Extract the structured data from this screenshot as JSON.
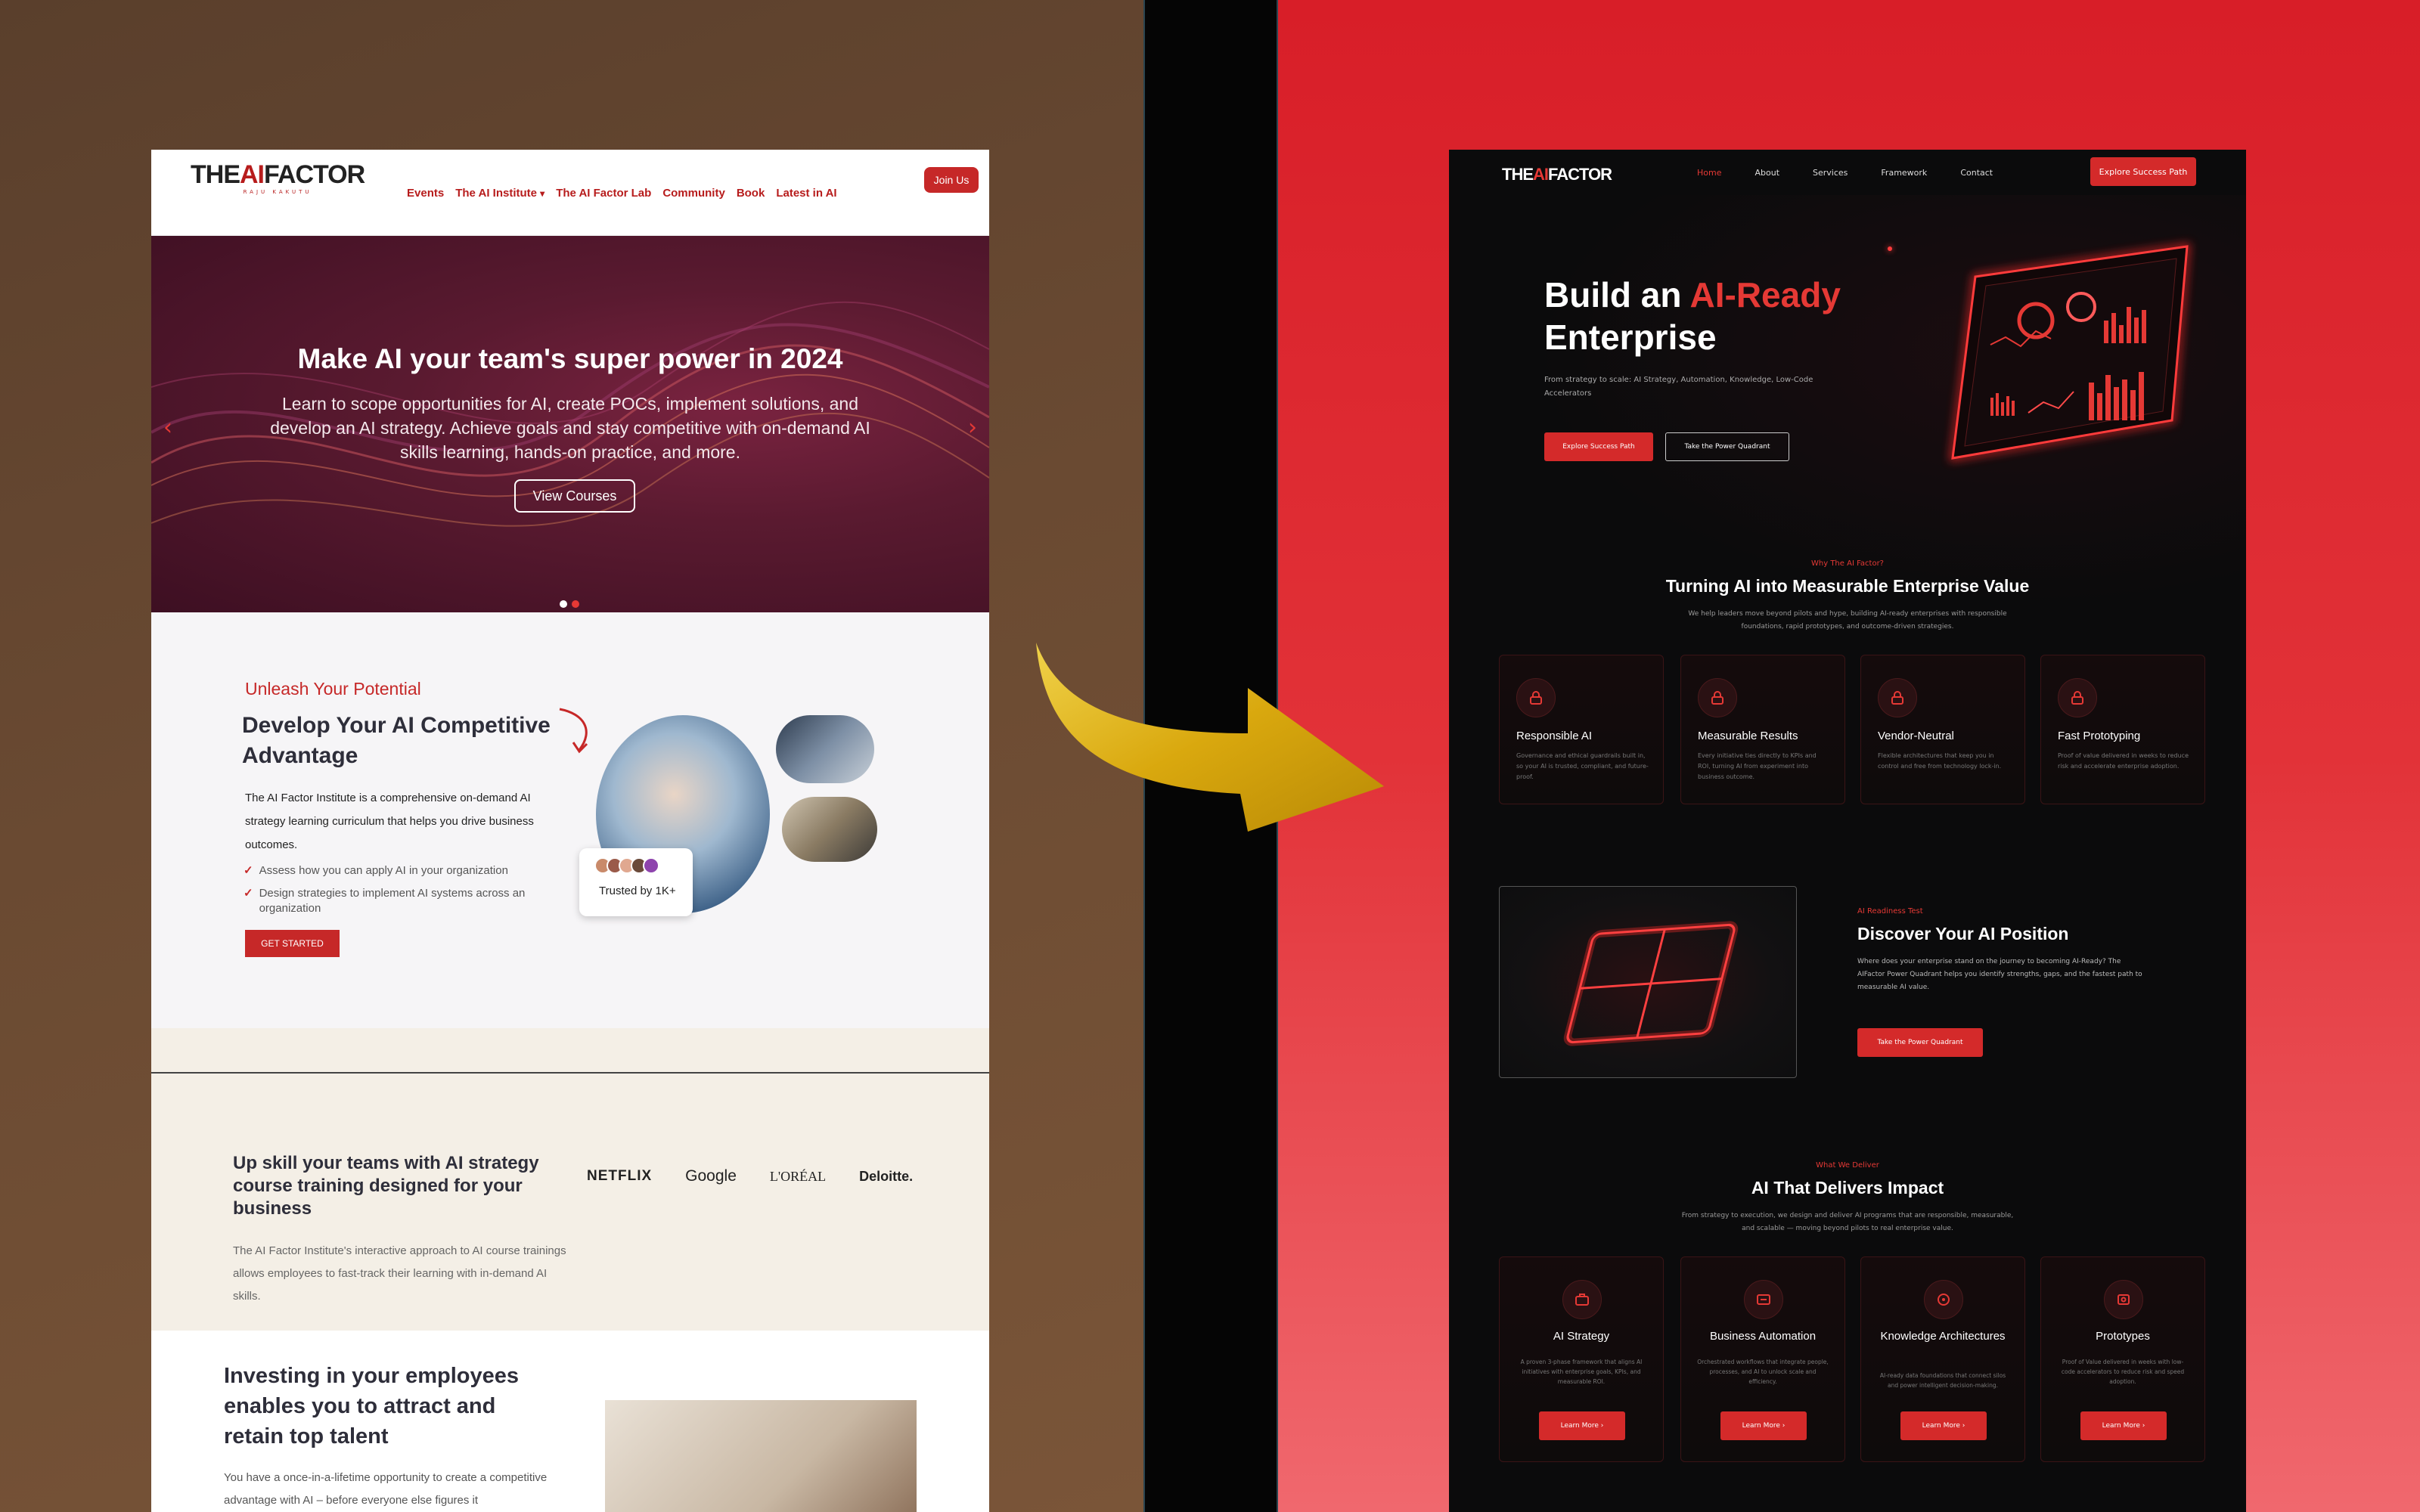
{
  "old_site": {
    "logo": {
      "prefix": "THE",
      "ai": "AI",
      "suffix": "FACTOR",
      "sub": "RAJU KAKUTU"
    },
    "nav": [
      "Events",
      "The AI Institute",
      "The AI Factor Lab",
      "Community",
      "Book",
      "Latest in AI"
    ],
    "nav_dropdown_marker": "▾",
    "join_label": "Join Us",
    "hero": {
      "title": "Make AI your team's super power in 2024",
      "text": "Learn to scope opportunities for AI, create POCs, implement solutions, and develop an AI strategy. Achieve goals and stay competitive with on-demand AI skills learning, hands-on practice, and more.",
      "cta": "View Courses",
      "prev": "‹",
      "next": "›"
    },
    "section2": {
      "eyebrow": "Unleash Your Potential",
      "title": "Develop Your AI Competitive Advantage",
      "text": "The AI Factor Institute is a comprehensive on-demand AI strategy learning curriculum that helps you drive business outcomes.",
      "checks": [
        "Assess how you can apply AI in your organization",
        "Design strategies to implement AI systems across an organization"
      ],
      "check_mark": "✓",
      "cta": "GET STARTED",
      "trusted": "Trusted by 1K+"
    },
    "section3": {
      "title": "Up skill your teams with AI strategy course training designed for your business",
      "text": "The AI Factor Institute's interactive approach to AI course trainings allows employees to fast-track their learning with in-demand AI skills.",
      "logos": [
        "NETFLIX",
        "Google",
        "L'ORÉAL",
        "Deloitte."
      ]
    },
    "section4": {
      "title": "Investing in your employees enables you to attract and retain top talent",
      "text": "You have a once-in-a-lifetime opportunity to create a competitive advantage with AI – before everyone else figures it"
    }
  },
  "new_site": {
    "logo": {
      "prefix": "THE",
      "ai": "AI",
      "suffix": "FACTOR"
    },
    "nav": [
      "Home",
      "About",
      "Services",
      "Framework",
      "Contact"
    ],
    "nav_active": "Home",
    "cta": "Explore Success Path",
    "hero": {
      "title_1": "Build an ",
      "title_red": "AI-Ready",
      "title_2": "Enterprise",
      "subtitle": "From strategy to scale: AI Strategy, Automation, Knowledge, Low-Code Accelerators",
      "btn_primary": "Explore Success Path",
      "btn_secondary": "Take the Power Quadrant"
    },
    "why": {
      "eyebrow": "Why The AI Factor?",
      "title": "Turning AI into Measurable Enterprise Value",
      "subtitle": "We help leaders move beyond pilots and hype, building AI-ready enterprises with responsible foundations, rapid prototypes, and outcome-driven strategies.",
      "cards": [
        {
          "title": "Responsible AI",
          "text": "Governance and ethical guardrails built in, so your AI is trusted, compliant, and future-proof."
        },
        {
          "title": "Measurable Results",
          "text": "Every initiative ties directly to KPIs and ROI, turning AI from experiment into business outcome."
        },
        {
          "title": "Vendor-Neutral",
          "text": "Flexible architectures that keep you in control and free from technology lock-in."
        },
        {
          "title": "Fast Prototyping",
          "text": "Proof of value delivered in weeks to reduce risk and accelerate enterprise adoption."
        }
      ]
    },
    "position": {
      "eyebrow": "AI Readiness Test",
      "title": "Discover Your AI Position",
      "text": "Where does your enterprise stand on the journey to becoming AI-Ready? The AIFactor Power Quadrant helps you identify strengths, gaps, and the fastest path to measurable AI value.",
      "cta": "Take the Power Quadrant"
    },
    "deliver": {
      "eyebrow": "What We Deliver",
      "title": "AI That Delivers Impact",
      "subtitle": "From strategy to execution, we design and deliver AI programs that are responsible, measurable, and scalable — moving beyond pilots to real enterprise value.",
      "cards": [
        {
          "title": "AI Strategy",
          "text": "A proven 3-phase framework that aligns AI initiatives with enterprise goals, KPIs, and measurable ROI.",
          "cta": "Learn More ›"
        },
        {
          "title": "Business Automation",
          "text": "Orchestrated workflows that integrate people, processes, and AI to unlock scale and efficiency.",
          "cta": "Learn More ›"
        },
        {
          "title": "Knowledge Architectures",
          "text": "AI-ready data foundations that connect silos and power intelligent decision-making.",
          "cta": "Learn More ›"
        },
        {
          "title": "Prototypes",
          "text": "Proof of Value delivered in weeks with low-code accelerators to reduce risk and speed adoption.",
          "cta": "Learn More ›"
        }
      ]
    }
  },
  "colors": {
    "brand_red": "#d42a2a",
    "old_red": "#c62828",
    "dark_bg": "#0b0b0c",
    "arrow_gold": "#e2b516"
  }
}
